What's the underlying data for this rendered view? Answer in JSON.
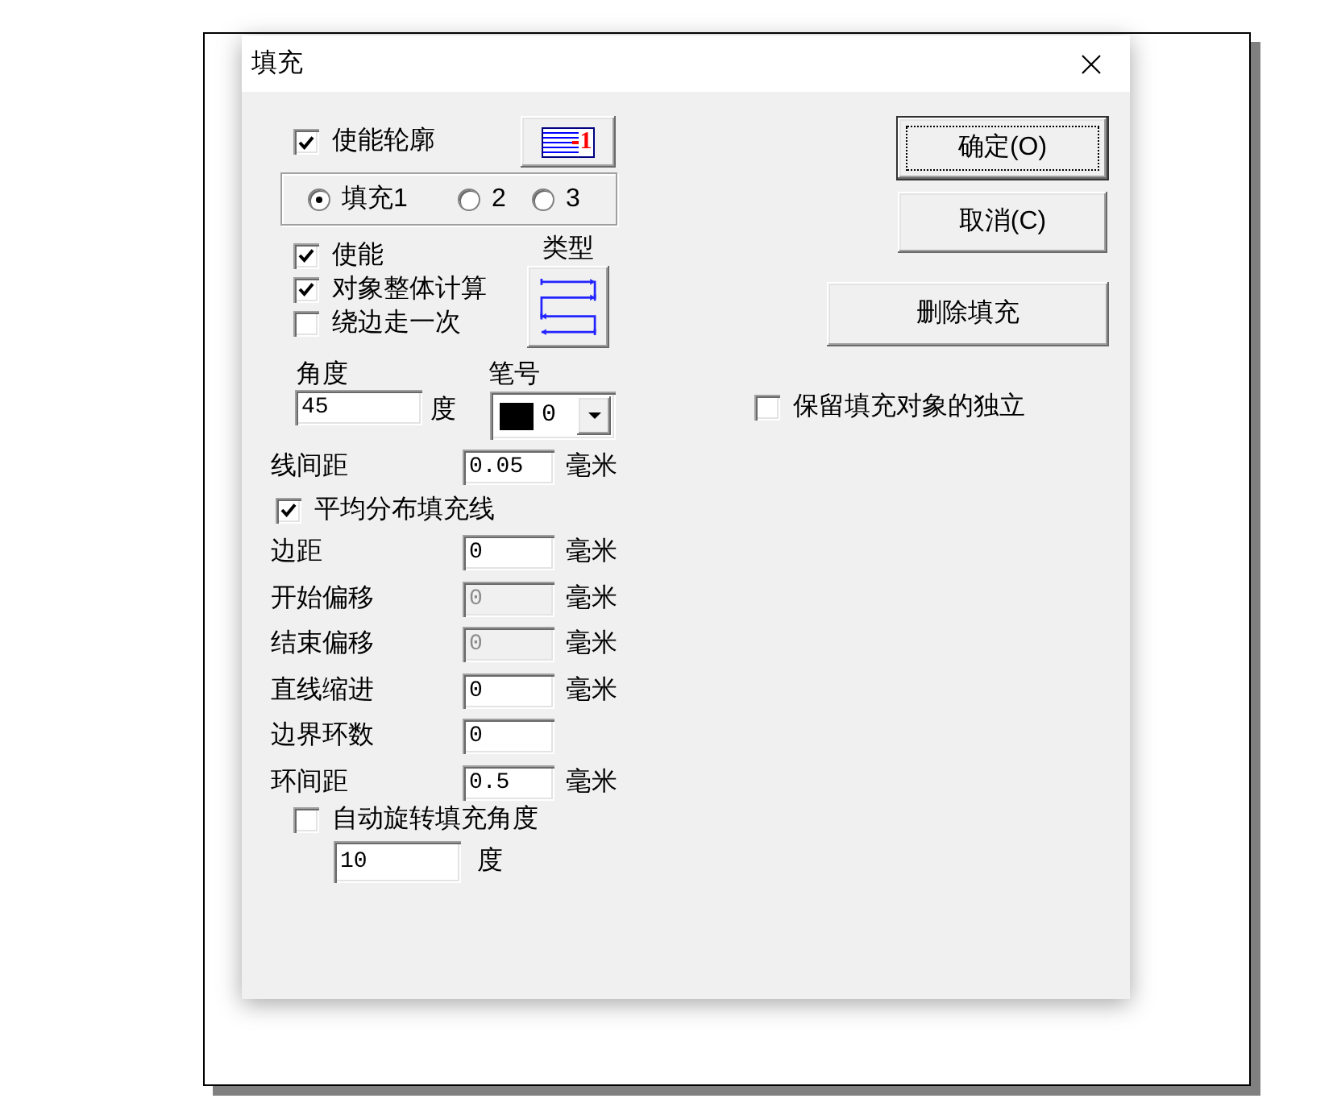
{
  "window": {
    "title": "填充"
  },
  "outline": {
    "label": "使能轮廓",
    "checked": true,
    "preview_mark": "1"
  },
  "fill_slots": [
    {
      "label": "填充1",
      "selected": true
    },
    {
      "label": "2",
      "selected": false
    },
    {
      "label": "3",
      "selected": false
    }
  ],
  "options": [
    {
      "label": "使能",
      "checked": true
    },
    {
      "label": "对象整体计算",
      "checked": true
    },
    {
      "label": "绕边走一次",
      "checked": false
    }
  ],
  "fill_type": {
    "label": "类型"
  },
  "angle": {
    "label": "角度",
    "value": "45",
    "unit": "度"
  },
  "pen": {
    "label": "笔号",
    "value": "0",
    "color": "#000000"
  },
  "line_spacing": {
    "label": "线间距",
    "value": "0.05",
    "unit": "毫米"
  },
  "even_distribution": {
    "label": "平均分布填充线",
    "checked": true
  },
  "offsets": [
    {
      "label": "边距",
      "value": "0",
      "unit": "毫米",
      "disabled": false
    },
    {
      "label": "开始偏移",
      "value": "0",
      "unit": "毫米",
      "disabled": true
    },
    {
      "label": "结束偏移",
      "value": "0",
      "unit": "毫米",
      "disabled": true
    },
    {
      "label": "直线缩进",
      "value": "0",
      "unit": "毫米",
      "disabled": false
    },
    {
      "label": "边界环数",
      "value": "0",
      "disabled": false
    },
    {
      "label": "环间距",
      "value": "0.5",
      "unit": "毫米",
      "disabled": false
    }
  ],
  "auto_rotate": {
    "label": "自动旋转填充角度",
    "checked": false
  },
  "rotate_step": {
    "value": "10",
    "unit": "度"
  },
  "buttons": [
    {
      "label": "确定(O)",
      "default": true
    },
    {
      "label": "取消(C)",
      "default": false
    }
  ],
  "delete_fill": {
    "label": "删除填充"
  },
  "keep_independent": {
    "label": "保留填充对象的独立",
    "checked": false
  }
}
